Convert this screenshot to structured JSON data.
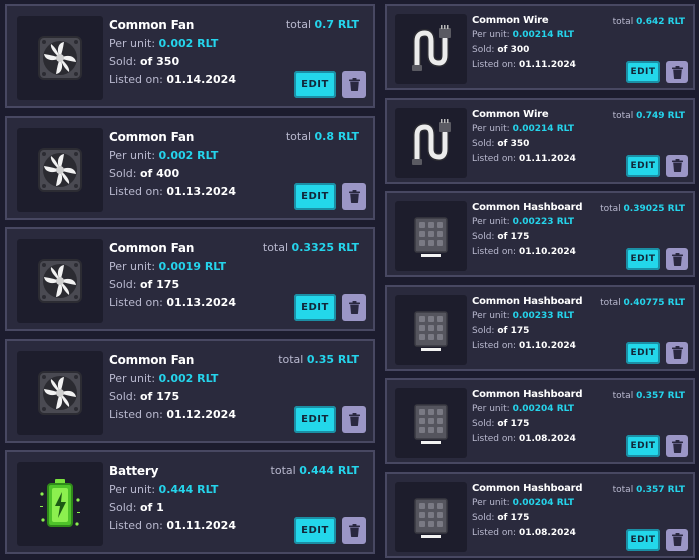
{
  "labels": {
    "per_unit": "Per unit:",
    "sold": "Sold:",
    "listed": "Listed on:",
    "total": "total",
    "edit": "EDIT"
  },
  "left_listings": [
    {
      "name": "Common Fan",
      "icon": "fan-icon",
      "total": "0.7 RLT",
      "per_unit": "0.002 RLT",
      "sold": "of 350",
      "listed": "01.14.2024"
    },
    {
      "name": "Common Fan",
      "icon": "fan-icon",
      "total": "0.8 RLT",
      "per_unit": "0.002 RLT",
      "sold": "of 400",
      "listed": "01.13.2024"
    },
    {
      "name": "Common Fan",
      "icon": "fan-icon",
      "total": "0.3325 RLT",
      "per_unit": "0.0019 RLT",
      "sold": "of 175",
      "listed": "01.13.2024"
    },
    {
      "name": "Common Fan",
      "icon": "fan-icon",
      "total": "0.35 RLT",
      "per_unit": "0.002 RLT",
      "sold": "of 175",
      "listed": "01.12.2024"
    },
    {
      "name": "Battery",
      "icon": "battery-icon",
      "total": "0.444 RLT",
      "per_unit": "0.444 RLT",
      "sold": "of 1",
      "listed": "01.11.2024"
    }
  ],
  "right_listings": [
    {
      "name": "Common Wire",
      "icon": "wire-icon",
      "total": "0.642 RLT",
      "per_unit": "0.00214 RLT",
      "sold": "of 300",
      "listed": "01.11.2024"
    },
    {
      "name": "Common Wire",
      "icon": "wire-icon",
      "total": "0.749 RLT",
      "per_unit": "0.00214 RLT",
      "sold": "of 350",
      "listed": "01.11.2024"
    },
    {
      "name": "Common Hashboard",
      "icon": "hashboard-icon",
      "total": "0.39025 RLT",
      "per_unit": "0.00223 RLT",
      "sold": "of 175",
      "listed": "01.10.2024"
    },
    {
      "name": "Common Hashboard",
      "icon": "hashboard-icon",
      "total": "0.40775 RLT",
      "per_unit": "0.00233 RLT",
      "sold": "of 175",
      "listed": "01.10.2024"
    },
    {
      "name": "Common Hashboard",
      "icon": "hashboard-icon",
      "total": "0.357 RLT",
      "per_unit": "0.00204 RLT",
      "sold": "of 175",
      "listed": "01.08.2024"
    },
    {
      "name": "Common Hashboard",
      "icon": "hashboard-icon",
      "total": "0.357 RLT",
      "per_unit": "0.00204 RLT",
      "sold": "of 175",
      "listed": "01.08.2024"
    }
  ],
  "colors": {
    "accent": "#25d4eb",
    "card_bg": "#2a2a3d",
    "trash": "#9b96c6"
  }
}
